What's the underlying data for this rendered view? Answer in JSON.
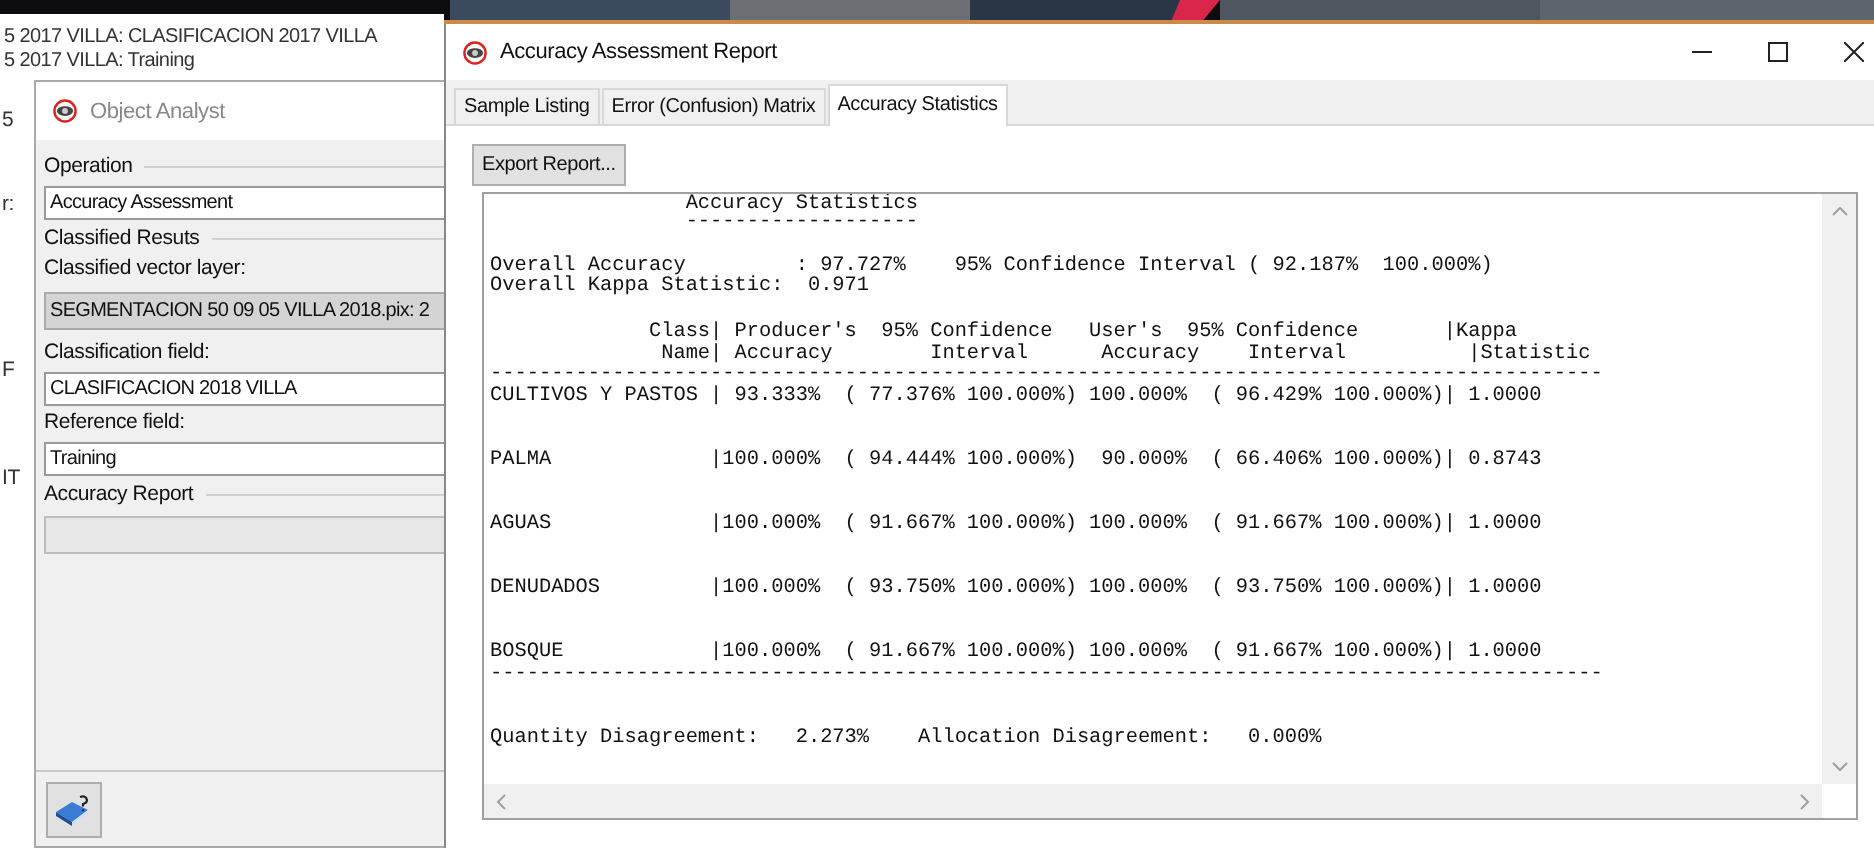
{
  "background_window": {
    "lines": [
      "5 2017 VILLA: CLASIFICACION 2017 VILLA",
      "5 2017 VILLA: Training"
    ],
    "fragments": [
      "5",
      "r:",
      "F",
      "IT"
    ]
  },
  "object_analyst": {
    "title": "Object Analyst",
    "items": [
      {
        "kind": "group",
        "text": "Operation"
      },
      {
        "kind": "field",
        "value": "Accuracy Assessment",
        "disabled": false
      },
      {
        "kind": "group",
        "text": "Classified Resuts"
      },
      {
        "kind": "label",
        "text": "Classified vector layer:"
      },
      {
        "kind": "field",
        "value": "SEGMENTACION 50 09 05 VILLA 2018.pix: 2",
        "disabled": true
      },
      {
        "kind": "label",
        "text": "Classification field:"
      },
      {
        "kind": "field",
        "value": "CLASIFICACION 2018 VILLA",
        "disabled": false
      },
      {
        "kind": "label",
        "text": "Reference field:"
      },
      {
        "kind": "field",
        "value": "Training",
        "disabled": false
      },
      {
        "kind": "group",
        "text": "Accuracy Report"
      },
      {
        "kind": "progress"
      }
    ]
  },
  "report_window": {
    "title": "Accuracy Assessment Report",
    "tabs": [
      {
        "label": "Sample Listing",
        "selected": false
      },
      {
        "label": "Error (Confusion) Matrix",
        "selected": false
      },
      {
        "label": "Accuracy Statistics",
        "selected": true
      }
    ],
    "export_button": "Export Report...",
    "report": {
      "title": "                Accuracy Statistics",
      "title_rule": "                -------------------",
      "overall": [
        "Overall Accuracy         : 97.727%    95% Confidence Interval ( 92.187%  100.000%)",
        "Overall Kappa Statistic:  0.971"
      ],
      "header": [
        "             Class| Producer's  95% Confidence   User's  95% Confidence       |Kappa",
        "              Name| Accuracy        Interval      Accuracy    Interval          |Statistic"
      ],
      "rule": "-------------------------------------------------------------------------------------------",
      "rows": [
        "CULTIVOS Y PASTOS | 93.333%  ( 77.376% 100.000%) 100.000%  ( 96.429% 100.000%)| 1.0000",
        "PALMA             |100.000%  ( 94.444% 100.000%)  90.000%  ( 66.406% 100.000%)| 0.8743",
        "AGUAS             |100.000%  ( 91.667% 100.000%) 100.000%  ( 91.667% 100.000%)| 1.0000",
        "DENUDADOS         |100.000%  ( 93.750% 100.000%) 100.000%  ( 93.750% 100.000%)| 1.0000",
        "BOSQUE            |100.000%  ( 91.667% 100.000%) 100.000%  ( 91.667% 100.000%)| 1.0000"
      ],
      "bottom_rule": "-------------------------------------------------------------------------------------------",
      "disagreement": "Quantity Disagreement:   2.273%    Allocation Disagreement:   0.000%"
    }
  }
}
